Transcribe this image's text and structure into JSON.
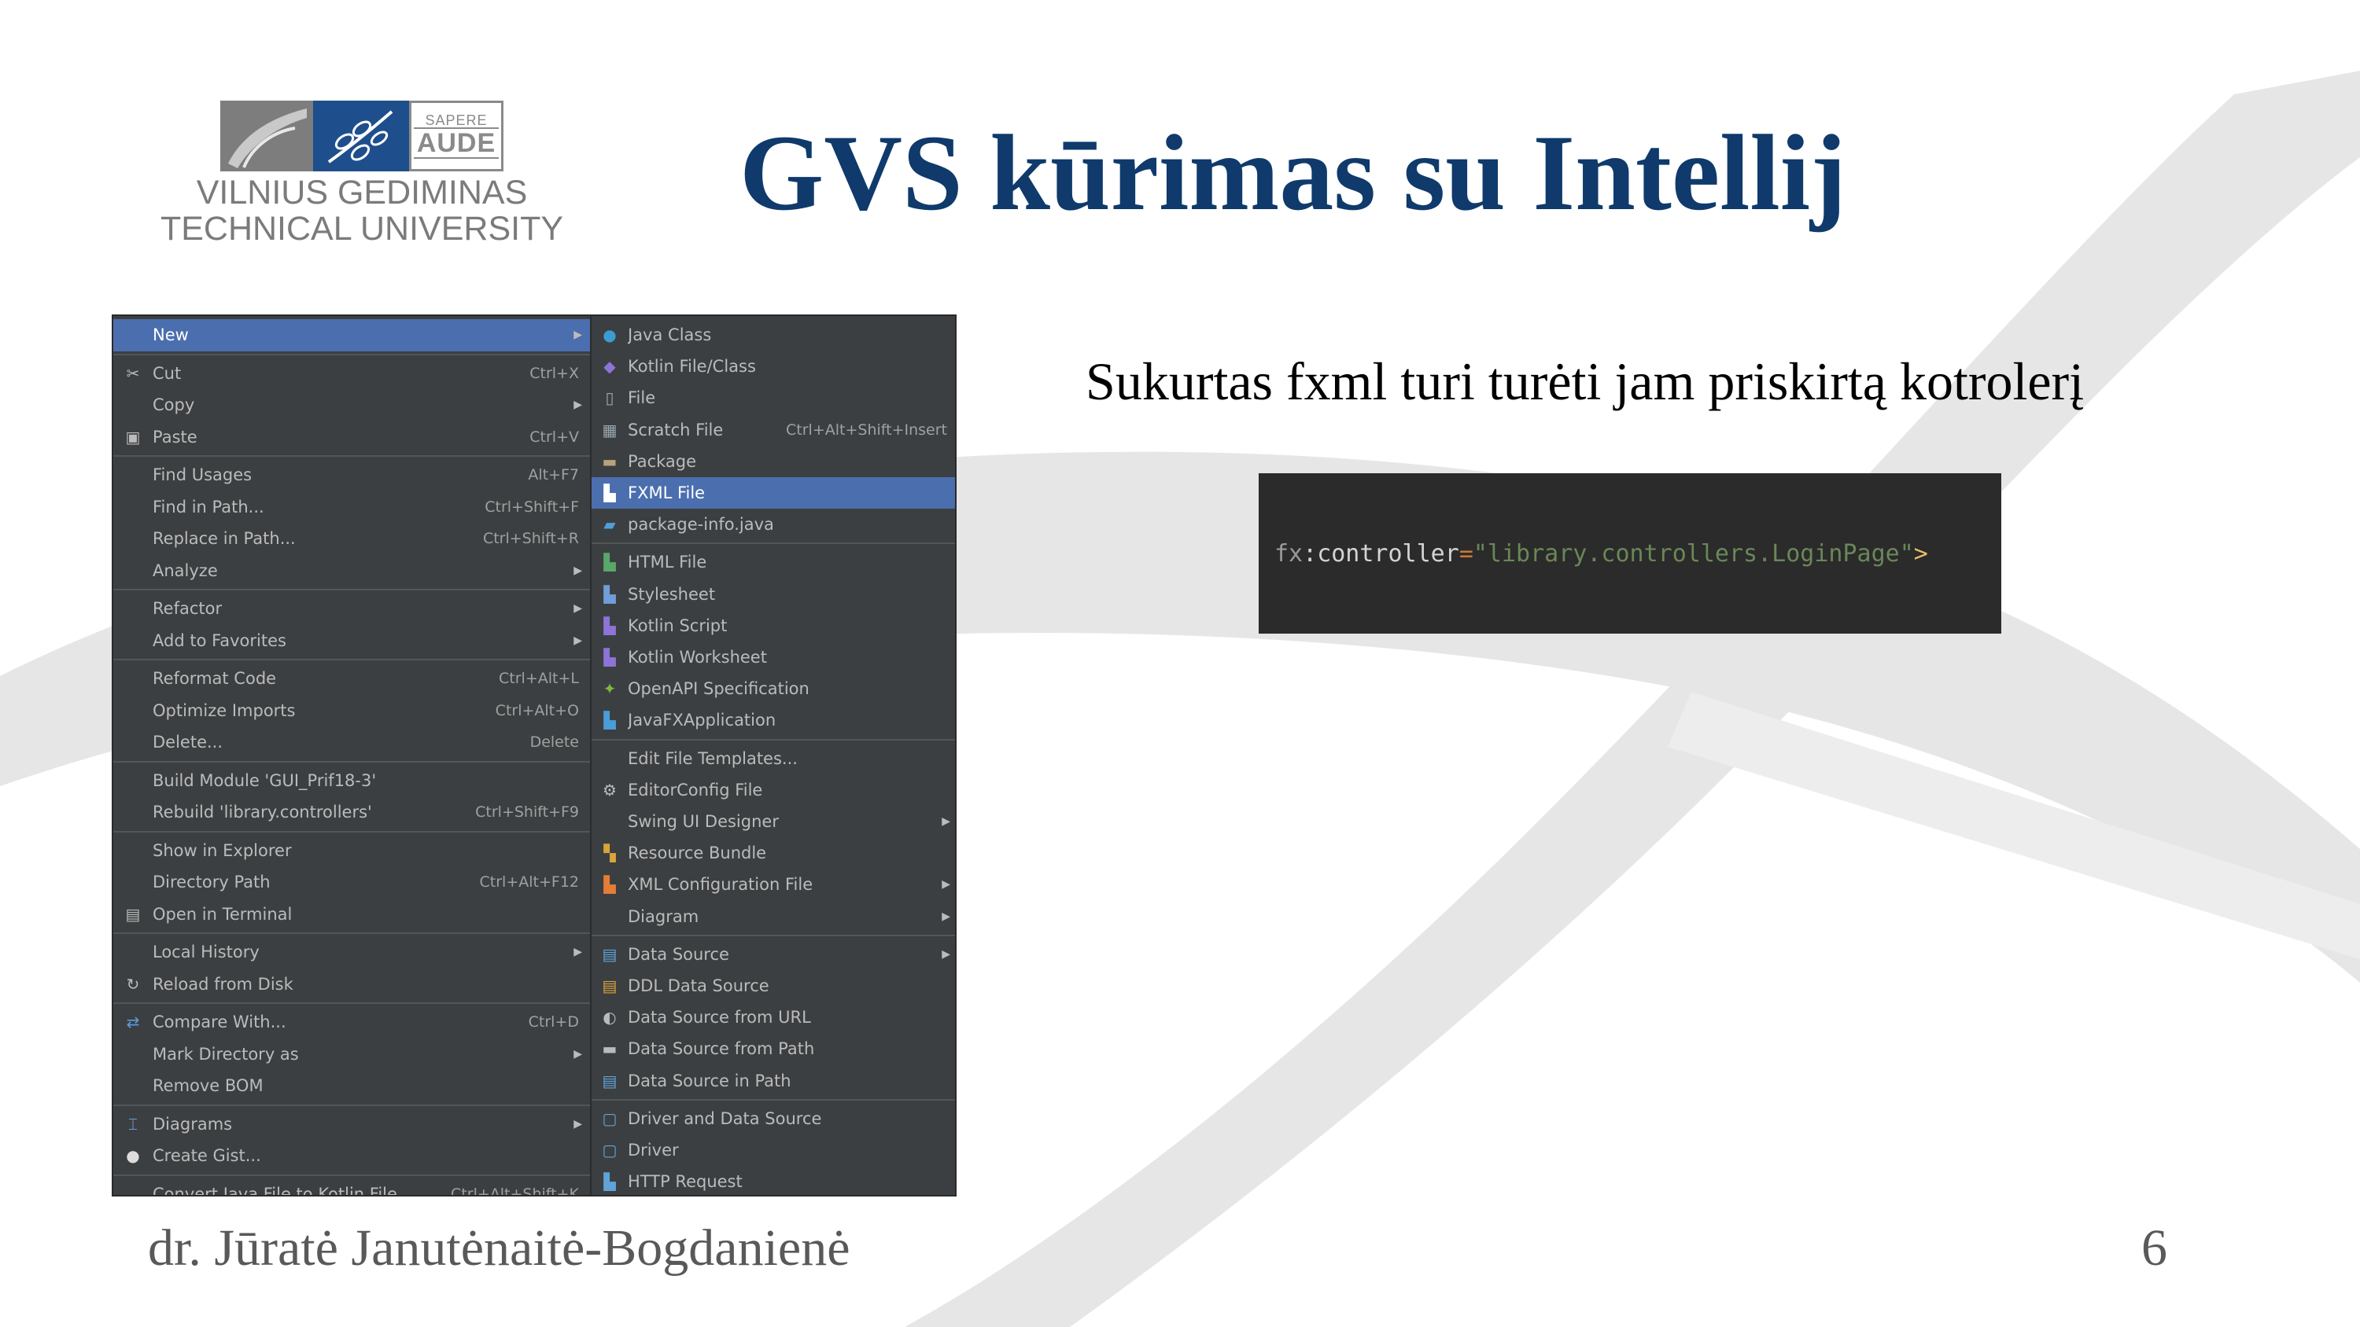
{
  "slide": {
    "title": "GVS kūrimas su Intellij",
    "caption": "Sukurtas fxml turi turėti jam priskirtą kotrolerį",
    "author": "dr. Jūratė Janutėnaitė-Bogdanienė",
    "page_number": "6"
  },
  "logo": {
    "motto_line1": "SAPERE",
    "motto_line2": "AUDE",
    "name_line1": "VILNIUS GEDIMINAS",
    "name_line2": "TECHNICAL UNIVERSITY"
  },
  "code": {
    "ns": "fx",
    "colon": ":",
    "attr": "controller",
    "eq": "=",
    "value": "\"library.controllers.LoginPage\"",
    "end": ">"
  },
  "colors": {
    "title": "#0f3a6b",
    "menu_bg": "#3c3f41",
    "menu_selected": "#4b6eaf",
    "code_bg": "#2b2b2b"
  },
  "context_menu": [
    {
      "label": "New",
      "shortcut": "",
      "submenu": true,
      "selected": true,
      "icon": ""
    },
    {
      "label": "Cut",
      "shortcut": "Ctrl+X",
      "icon": "scissors-icon"
    },
    {
      "label": "Copy",
      "shortcut": "",
      "submenu": true,
      "icon": ""
    },
    {
      "label": "Paste",
      "shortcut": "Ctrl+V",
      "icon": "clipboard-icon"
    },
    {
      "label": "Find Usages",
      "shortcut": "Alt+F7",
      "icon": ""
    },
    {
      "label": "Find in Path...",
      "shortcut": "Ctrl+Shift+F",
      "icon": ""
    },
    {
      "label": "Replace in Path...",
      "shortcut": "Ctrl+Shift+R",
      "icon": ""
    },
    {
      "label": "Analyze",
      "shortcut": "",
      "submenu": true,
      "icon": ""
    },
    {
      "label": "Refactor",
      "shortcut": "",
      "submenu": true,
      "icon": ""
    },
    {
      "label": "Add to Favorites",
      "shortcut": "",
      "submenu": true,
      "icon": ""
    },
    {
      "label": "Reformat Code",
      "shortcut": "Ctrl+Alt+L",
      "icon": ""
    },
    {
      "label": "Optimize Imports",
      "shortcut": "Ctrl+Alt+O",
      "icon": ""
    },
    {
      "label": "Delete...",
      "shortcut": "Delete",
      "icon": ""
    },
    {
      "label": "Build Module 'GUI_Prif18-3'",
      "shortcut": "",
      "icon": ""
    },
    {
      "label": "Rebuild 'library.controllers'",
      "shortcut": "Ctrl+Shift+F9",
      "icon": ""
    },
    {
      "label": "Show in Explorer",
      "shortcut": "",
      "icon": ""
    },
    {
      "label": "Directory Path",
      "shortcut": "Ctrl+Alt+F12",
      "icon": ""
    },
    {
      "label": "Open in Terminal",
      "shortcut": "",
      "icon": "terminal-icon"
    },
    {
      "label": "Local History",
      "shortcut": "",
      "submenu": true,
      "icon": ""
    },
    {
      "label": "Reload from Disk",
      "shortcut": "",
      "icon": "reload-icon"
    },
    {
      "label": "Compare With...",
      "shortcut": "Ctrl+D",
      "icon": "compare-icon"
    },
    {
      "label": "Mark Directory as",
      "shortcut": "",
      "submenu": true,
      "icon": ""
    },
    {
      "label": "Remove BOM",
      "shortcut": "",
      "icon": ""
    },
    {
      "label": "Diagrams",
      "shortcut": "",
      "submenu": true,
      "icon": "diagram-icon"
    },
    {
      "label": "Create Gist...",
      "shortcut": "",
      "icon": "github-icon"
    },
    {
      "label": "Convert Java File to Kotlin File",
      "shortcut": "Ctrl+Alt+Shift+K",
      "icon": ""
    }
  ],
  "new_submenu": [
    {
      "label": "Java Class",
      "shortcut": "",
      "icon": "java-class-icon"
    },
    {
      "label": "Kotlin File/Class",
      "shortcut": "",
      "icon": "kotlin-file-icon"
    },
    {
      "label": "File",
      "shortcut": "",
      "icon": "file-icon"
    },
    {
      "label": "Scratch File",
      "shortcut": "Ctrl+Alt+Shift+Insert",
      "icon": "scratch-file-icon"
    },
    {
      "label": "Package",
      "shortcut": "",
      "icon": "package-icon"
    },
    {
      "label": "FXML File",
      "shortcut": "",
      "selected": true,
      "icon": "fxml-file-icon"
    },
    {
      "label": "package-info.java",
      "shortcut": "",
      "icon": "package-info-icon"
    },
    {
      "label": "HTML File",
      "shortcut": "",
      "icon": "html-file-icon"
    },
    {
      "label": "Stylesheet",
      "shortcut": "",
      "icon": "stylesheet-icon"
    },
    {
      "label": "Kotlin Script",
      "shortcut": "",
      "icon": "kotlin-script-icon"
    },
    {
      "label": "Kotlin Worksheet",
      "shortcut": "",
      "icon": "kotlin-worksheet-icon"
    },
    {
      "label": "OpenAPI Specification",
      "shortcut": "",
      "icon": "openapi-icon"
    },
    {
      "label": "JavaFXApplication",
      "shortcut": "",
      "icon": "javafx-icon"
    },
    {
      "label": "Edit File Templates...",
      "shortcut": "",
      "icon": ""
    },
    {
      "label": "EditorConfig File",
      "shortcut": "",
      "icon": "gear-icon"
    },
    {
      "label": "Swing UI Designer",
      "shortcut": "",
      "submenu": true,
      "icon": ""
    },
    {
      "label": "Resource Bundle",
      "shortcut": "",
      "icon": "resource-bundle-icon"
    },
    {
      "label": "XML Configuration File",
      "shortcut": "",
      "submenu": true,
      "icon": "xml-file-icon"
    },
    {
      "label": "Diagram",
      "shortcut": "",
      "submenu": true,
      "icon": ""
    },
    {
      "label": "Data Source",
      "shortcut": "",
      "submenu": true,
      "icon": "database-icon"
    },
    {
      "label": "DDL Data Source",
      "shortcut": "",
      "icon": "ddl-icon"
    },
    {
      "label": "Data Source from URL",
      "shortcut": "",
      "icon": "url-icon"
    },
    {
      "label": "Data Source from Path",
      "shortcut": "",
      "icon": "folder-icon"
    },
    {
      "label": "Data Source in Path",
      "shortcut": "",
      "icon": "database-path-icon"
    },
    {
      "label": "Driver and Data Source",
      "shortcut": "",
      "icon": "driver-source-icon"
    },
    {
      "label": "Driver",
      "shortcut": "",
      "icon": "driver-icon"
    },
    {
      "label": "HTTP Request",
      "shortcut": "",
      "icon": "http-request-icon"
    }
  ]
}
